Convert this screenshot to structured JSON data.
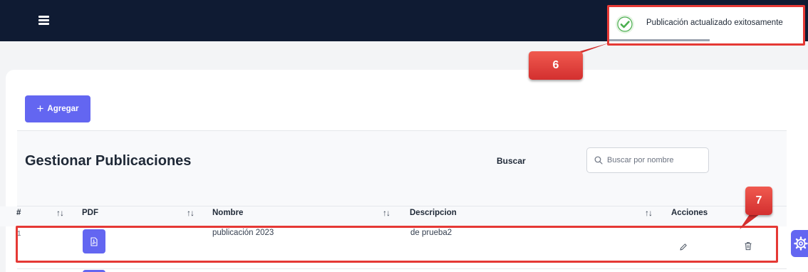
{
  "topbar": {
    "menu_icon": "hamburger-menu-icon"
  },
  "toolbar": {
    "add_label": "Agregar",
    "add_icon": "plus-icon"
  },
  "page": {
    "title": "Gestionar Publicaciones"
  },
  "search": {
    "label": "Buscar",
    "placeholder": "Buscar por nombre",
    "value": "",
    "icon": "search-icon"
  },
  "table": {
    "columns": [
      {
        "key": "index",
        "label": "#",
        "sortable": true
      },
      {
        "key": "pdf",
        "label": "PDF",
        "sortable": true
      },
      {
        "key": "nombre",
        "label": "Nombre",
        "sortable": true
      },
      {
        "key": "descripcion",
        "label": "Descripcion",
        "sortable": true
      },
      {
        "key": "acciones",
        "label": "Acciones",
        "sortable": false
      }
    ],
    "sort_glyph": "↑↓",
    "rows": [
      {
        "index": "1",
        "pdf_icon": "pdf-file-icon",
        "nombre": "publicación 2023",
        "descripcion": "de prueba2",
        "edit_icon": "pencil-icon",
        "delete_icon": "trash-icon"
      }
    ]
  },
  "toast": {
    "message": "Publicación actualizado exitosamente",
    "icon": "check-circle-icon",
    "progress": 0.52
  },
  "annotations": [
    {
      "number": "6",
      "target": "toast"
    },
    {
      "number": "7",
      "target": "table-row"
    }
  ],
  "floating": {
    "settings_icon": "gear-icon"
  },
  "colors": {
    "topbar": "#0f1b33",
    "primary": "#6366f1",
    "annotation_red": "#e53935",
    "success_green": "#4caf50",
    "page_background": "#f3f4f6"
  }
}
